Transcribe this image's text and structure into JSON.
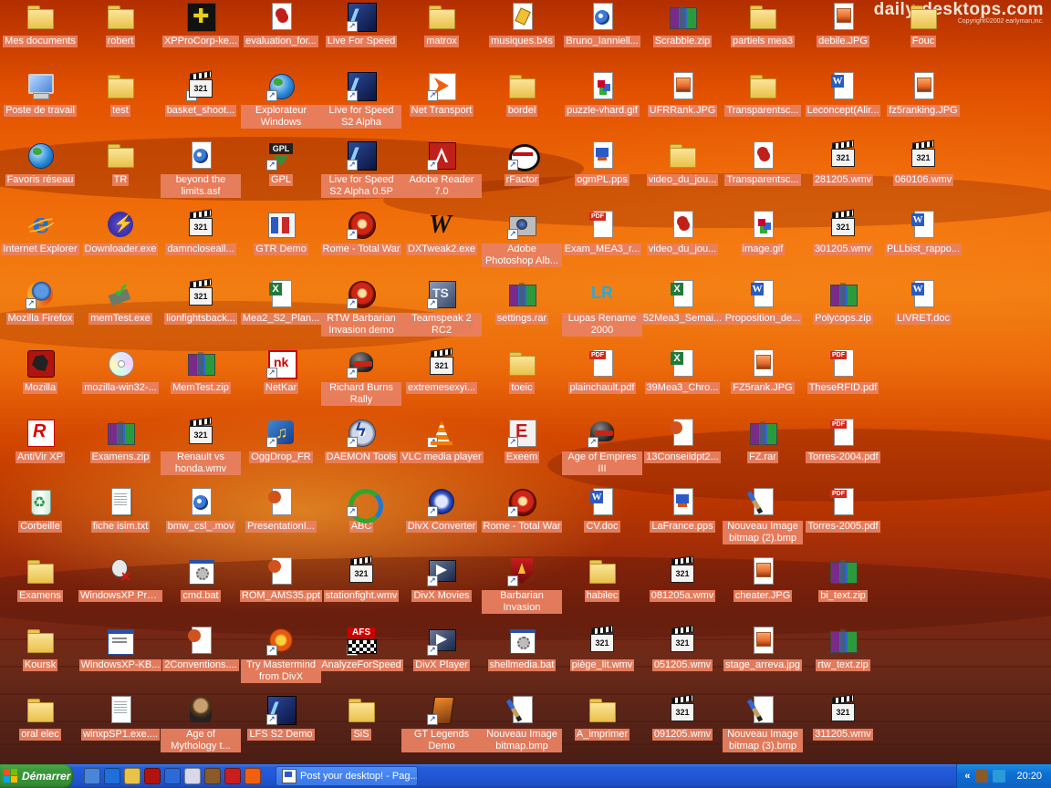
{
  "wallpaper": {
    "brand": "daily-desktops.com",
    "copyright": "Copyright©2002 earlyman,inc."
  },
  "desktop": {
    "icons": [
      {
        "label": "Mes documents",
        "kind": "folder",
        "col": 0,
        "row": 0
      },
      {
        "label": "Poste de travail",
        "kind": "computer",
        "col": 0,
        "row": 1
      },
      {
        "label": "Favoris réseau",
        "kind": "globe",
        "col": 0,
        "row": 2
      },
      {
        "label": "Internet Explorer",
        "kind": "ie",
        "col": 0,
        "row": 3
      },
      {
        "label": "Mozilla Firefox",
        "kind": "firefox",
        "col": 0,
        "row": 4,
        "shortcut": true
      },
      {
        "label": "Mozilla",
        "kind": "mozilla",
        "col": 0,
        "row": 5
      },
      {
        "label": "AntiVir XP",
        "kind": "avira",
        "col": 0,
        "row": 6
      },
      {
        "label": "Corbeille",
        "kind": "recycle",
        "col": 0,
        "row": 7
      },
      {
        "label": "Examens",
        "kind": "folder",
        "col": 0,
        "row": 8
      },
      {
        "label": "Koursk",
        "kind": "folder",
        "col": 0,
        "row": 9
      },
      {
        "label": "oral elec",
        "kind": "folder",
        "col": 0,
        "row": 10
      },
      {
        "label": "robert",
        "kind": "folder",
        "col": 1,
        "row": 0
      },
      {
        "label": "test",
        "kind": "folder",
        "col": 1,
        "row": 1
      },
      {
        "label": "TR",
        "kind": "folder",
        "col": 1,
        "row": 2
      },
      {
        "label": "Downloader.exe",
        "kind": "bolt",
        "col": 1,
        "row": 3
      },
      {
        "label": "memTest.exe",
        "kind": "check",
        "col": 1,
        "row": 4
      },
      {
        "label": "mozilla-win32-...",
        "kind": "cd",
        "col": 1,
        "row": 5
      },
      {
        "label": "Examens.zip",
        "kind": "zip",
        "col": 1,
        "row": 6
      },
      {
        "label": "fiche isim.txt",
        "kind": "doc",
        "col": 1,
        "row": 7
      },
      {
        "label": "WindowsXP Product K...",
        "kind": "keygen",
        "col": 1,
        "row": 8
      },
      {
        "label": "WindowsXP-KB...",
        "kind": "exe",
        "col": 1,
        "row": 9
      },
      {
        "label": "winxpSP1.exe....",
        "kind": "doc",
        "col": 1,
        "row": 10
      },
      {
        "label": "XPProCorp-ke...",
        "kind": "xpp",
        "col": 2,
        "row": 0
      },
      {
        "label": "basket_shoot...",
        "kind": "video",
        "col": 2,
        "row": 1,
        "shortcut": true
      },
      {
        "label": "beyond the limits.asf",
        "kind": "media",
        "col": 2,
        "row": 2,
        "two": true
      },
      {
        "label": "damncloseall...",
        "kind": "video",
        "col": 2,
        "row": 3
      },
      {
        "label": "lionfightsback...",
        "kind": "video",
        "col": 2,
        "row": 4
      },
      {
        "label": "MemTest.zip",
        "kind": "zip",
        "col": 2,
        "row": 5
      },
      {
        "label": "Renault vs honda.wmv",
        "kind": "video",
        "col": 2,
        "row": 6,
        "two": true
      },
      {
        "label": "bmw_csl_.mov",
        "kind": "media",
        "col": 2,
        "row": 7
      },
      {
        "label": "cmd.bat",
        "kind": "bat",
        "col": 2,
        "row": 8
      },
      {
        "label": "2Conventions....",
        "kind": "ppt",
        "col": 2,
        "row": 9
      },
      {
        "label": "Age of Mythology t...",
        "kind": "warrior",
        "col": 2,
        "row": 10,
        "two": true
      },
      {
        "label": "evaluation_for...",
        "kind": "swirl",
        "col": 3,
        "row": 0
      },
      {
        "label": "Explorateur Windows",
        "kind": "globe",
        "col": 3,
        "row": 1,
        "shortcut": true,
        "two": true
      },
      {
        "label": "GPL",
        "kind": "gpl",
        "col": 3,
        "row": 2,
        "shortcut": true
      },
      {
        "label": "GTR Demo",
        "kind": "gui",
        "col": 3,
        "row": 3
      },
      {
        "label": "Mea2_S2_Plan...",
        "kind": "excel",
        "col": 3,
        "row": 4
      },
      {
        "label": "NetKar",
        "kind": "netkar",
        "col": 3,
        "row": 5,
        "shortcut": true
      },
      {
        "label": "OggDrop_FR",
        "kind": "ogg",
        "col": 3,
        "row": 6,
        "shortcut": true
      },
      {
        "label": "PresentationI...",
        "kind": "ppt",
        "col": 3,
        "row": 7
      },
      {
        "label": "ROM_AMS35.ppt",
        "kind": "ppt",
        "col": 3,
        "row": 8
      },
      {
        "label": "Try Mastermind from DivX",
        "kind": "mastermind",
        "col": 3,
        "row": 9,
        "shortcut": true,
        "two": true
      },
      {
        "label": "LFS S2 Demo",
        "kind": "lfs",
        "col": 3,
        "row": 10,
        "shortcut": true
      },
      {
        "label": "Live For Speed",
        "kind": "lfs",
        "col": 4,
        "row": 0,
        "shortcut": true
      },
      {
        "label": "Live for Speed S2 Alpha",
        "kind": "lfs",
        "col": 4,
        "row": 1,
        "shortcut": true,
        "two": true
      },
      {
        "label": "Live for Speed S2 Alpha 0.5P",
        "kind": "lfs",
        "col": 4,
        "row": 2,
        "shortcut": true,
        "two": true
      },
      {
        "label": "Rome - Total War",
        "kind": "rome",
        "col": 4,
        "row": 3,
        "shortcut": true
      },
      {
        "label": "RTW Barbarian Invasion demo",
        "kind": "rome",
        "col": 4,
        "row": 4,
        "shortcut": true,
        "two": true
      },
      {
        "label": "Richard Burns Rally",
        "kind": "helmet",
        "col": 4,
        "row": 5,
        "shortcut": true,
        "two": true
      },
      {
        "label": "DAEMON Tools",
        "kind": "daemon",
        "col": 4,
        "row": 6,
        "shortcut": true
      },
      {
        "label": "ABC",
        "kind": "abc",
        "col": 4,
        "row": 7,
        "shortcut": true
      },
      {
        "label": "stationfight.wmv",
        "kind": "video",
        "col": 4,
        "row": 8
      },
      {
        "label": "AnalyzeForSpeed",
        "kind": "afs",
        "col": 4,
        "row": 9,
        "shortcut": true
      },
      {
        "label": "SiS",
        "kind": "folder",
        "col": 4,
        "row": 10
      },
      {
        "label": "matrox",
        "kind": "folder",
        "col": 5,
        "row": 0
      },
      {
        "label": "Net Transport",
        "kind": "net",
        "col": 5,
        "row": 1,
        "shortcut": true
      },
      {
        "label": "Adobe Reader 7.0",
        "kind": "red",
        "col": 5,
        "row": 2,
        "shortcut": true,
        "two": true
      },
      {
        "label": "DXTweak2.exe",
        "kind": "dxt",
        "col": 5,
        "row": 3
      },
      {
        "label": "Teamspeak 2 RC2",
        "kind": "ts",
        "col": 5,
        "row": 4,
        "shortcut": true,
        "two": true
      },
      {
        "label": "extremesexyi...",
        "kind": "video",
        "col": 5,
        "row": 5
      },
      {
        "label": "VLC media player",
        "kind": "vlc",
        "col": 5,
        "row": 6,
        "shortcut": true
      },
      {
        "label": "DivX Converter",
        "kind": "dvc",
        "col": 5,
        "row": 7,
        "shortcut": true
      },
      {
        "label": "DivX Movies",
        "kind": "divxplayer",
        "col": 5,
        "row": 8,
        "shortcut": true
      },
      {
        "label": "DivX Player",
        "kind": "divxplayer",
        "col": 5,
        "row": 9,
        "shortcut": true
      },
      {
        "label": "GT Legends Demo",
        "kind": "gtl",
        "col": 5,
        "row": 10,
        "shortcut": true,
        "two": true
      },
      {
        "label": "musiques.b4s",
        "kind": "b4s",
        "col": 6,
        "row": 0
      },
      {
        "label": "bordel",
        "kind": "folder",
        "col": 6,
        "row": 1
      },
      {
        "label": "rFactor",
        "kind": "rfactor",
        "col": 6,
        "row": 2,
        "shortcut": true
      },
      {
        "label": "Adobe Photoshop Alb...",
        "kind": "camera",
        "col": 6,
        "row": 3,
        "shortcut": true,
        "two": true
      },
      {
        "label": "settings.rar",
        "kind": "zip",
        "col": 6,
        "row": 4
      },
      {
        "label": "toeic",
        "kind": "folder",
        "col": 6,
        "row": 5
      },
      {
        "label": "Exeem",
        "kind": "exeem",
        "col": 6,
        "row": 6,
        "shortcut": true
      },
      {
        "label": "Rome - Total War",
        "kind": "rome",
        "col": 6,
        "row": 7,
        "shortcut": true
      },
      {
        "label": "Barbarian Invasion",
        "kind": "shield",
        "col": 6,
        "row": 8,
        "shortcut": true,
        "two": true
      },
      {
        "label": "shellmedia.bat",
        "kind": "bat",
        "col": 6,
        "row": 9
      },
      {
        "label": "Nouveau Image bitmap.bmp",
        "kind": "paint",
        "col": 6,
        "row": 10,
        "two": true
      },
      {
        "label": "Bruno_Ianniell...",
        "kind": "media",
        "col": 7,
        "row": 0
      },
      {
        "label": "puzzle-vhard.gif",
        "kind": "gif",
        "col": 7,
        "row": 1
      },
      {
        "label": "ogmPL.pps",
        "kind": "pps",
        "col": 7,
        "row": 2
      },
      {
        "label": "Exam_MEA3_r...",
        "kind": "pdf",
        "col": 7,
        "row": 3
      },
      {
        "label": "Lupas Rename 2000",
        "kind": "lupas",
        "col": 7,
        "row": 4,
        "two": true
      },
      {
        "label": "plainchault.pdf",
        "kind": "pdf",
        "col": 7,
        "row": 5
      },
      {
        "label": "Age of Empires III",
        "kind": "helmet",
        "col": 7,
        "row": 6,
        "shortcut": true,
        "two": true
      },
      {
        "label": "CV.doc",
        "kind": "word",
        "col": 7,
        "row": 7
      },
      {
        "label": "habilec",
        "kind": "folder",
        "col": 7,
        "row": 8
      },
      {
        "label": "piège_lit.wmv",
        "kind": "video",
        "col": 7,
        "row": 9
      },
      {
        "label": "A_imprimer",
        "kind": "folder",
        "col": 7,
        "row": 10
      },
      {
        "label": "Scrabble.zip",
        "kind": "zip",
        "col": 8,
        "row": 0
      },
      {
        "label": "UFRRank.JPG",
        "kind": "image",
        "col": 8,
        "row": 1
      },
      {
        "label": "video_du_jou...",
        "kind": "folder",
        "col": 8,
        "row": 2
      },
      {
        "label": "video_du_jou...",
        "kind": "swirl",
        "col": 8,
        "row": 3
      },
      {
        "label": "52Mea3_Semai...",
        "kind": "excel",
        "col": 8,
        "row": 4
      },
      {
        "label": "39Mea3_Chro...",
        "kind": "excel",
        "col": 8,
        "row": 5
      },
      {
        "label": "13Conseildpt2...",
        "kind": "ppt",
        "col": 8,
        "row": 6
      },
      {
        "label": "LaFrance.pps",
        "kind": "pps",
        "col": 8,
        "row": 7
      },
      {
        "label": "081205a.wmv",
        "kind": "video",
        "col": 8,
        "row": 8
      },
      {
        "label": "051205.wmv",
        "kind": "video",
        "col": 8,
        "row": 9
      },
      {
        "label": "091205.wmv",
        "kind": "video",
        "col": 8,
        "row": 10
      },
      {
        "label": "partiels mea3",
        "kind": "folder",
        "col": 9,
        "row": 0
      },
      {
        "label": "Transparentsc...",
        "kind": "folder",
        "col": 9,
        "row": 1
      },
      {
        "label": "Transparentsc...",
        "kind": "swirl",
        "col": 9,
        "row": 2
      },
      {
        "label": "image.gif",
        "kind": "gif",
        "col": 9,
        "row": 3
      },
      {
        "label": "Proposition_de...",
        "kind": "word",
        "col": 9,
        "row": 4
      },
      {
        "label": "FZ5rank.JPG",
        "kind": "image",
        "col": 9,
        "row": 5
      },
      {
        "label": "FZ.rar",
        "kind": "zip",
        "col": 9,
        "row": 6
      },
      {
        "label": "Nouveau Image bitmap (2).bmp",
        "kind": "paint",
        "col": 9,
        "row": 7,
        "two": true
      },
      {
        "label": "cheater.JPG",
        "kind": "image",
        "col": 9,
        "row": 8
      },
      {
        "label": "stage_arreva.jpg",
        "kind": "image",
        "col": 9,
        "row": 9
      },
      {
        "label": "Nouveau Image bitmap (3).bmp",
        "kind": "paint",
        "col": 9,
        "row": 10,
        "two": true
      },
      {
        "label": "debile.JPG",
        "kind": "image",
        "col": 10,
        "row": 0
      },
      {
        "label": "Leconcept(Alir...",
        "kind": "word",
        "col": 10,
        "row": 1
      },
      {
        "label": "281205.wmv",
        "kind": "video",
        "col": 10,
        "row": 2
      },
      {
        "label": "301205.wmv",
        "kind": "video",
        "col": 10,
        "row": 3
      },
      {
        "label": "Polycops.zip",
        "kind": "zip",
        "col": 10,
        "row": 4
      },
      {
        "label": "TheseRFID.pdf",
        "kind": "pdf",
        "col": 10,
        "row": 5
      },
      {
        "label": "Torres-2004.pdf",
        "kind": "pdf",
        "col": 10,
        "row": 6
      },
      {
        "label": "Torres-2005.pdf",
        "kind": "pdf",
        "col": 10,
        "row": 7
      },
      {
        "label": "bi_text.zip",
        "kind": "zip",
        "col": 10,
        "row": 8
      },
      {
        "label": "rtw_text.zip",
        "kind": "zip",
        "col": 10,
        "row": 9
      },
      {
        "label": "311205.wmv",
        "kind": "video",
        "col": 10,
        "row": 10
      },
      {
        "label": "Fouc",
        "kind": "folder",
        "col": 11,
        "row": 0
      },
      {
        "label": "fz5ranking.JPG",
        "kind": "image",
        "col": 11,
        "row": 1
      },
      {
        "label": "060106.wmv",
        "kind": "video",
        "col": 11,
        "row": 2
      },
      {
        "label": "PLLbist_rappo...",
        "kind": "word",
        "col": 11,
        "row": 3
      },
      {
        "label": "LIVRET.doc",
        "kind": "word",
        "col": 11,
        "row": 4
      }
    ]
  },
  "taskbar": {
    "start_label": "Démarrer",
    "quick_launch": [
      {
        "icon": "desktop-icon",
        "color": "#4a86d8"
      },
      {
        "icon": "ie-icon",
        "color": "#1e6fd9"
      },
      {
        "icon": "folder-icon",
        "color": "#e9c24a"
      },
      {
        "icon": "mozilla-icon",
        "color": "#b1140e"
      },
      {
        "icon": "media-player-icon",
        "color": "#2d6ad8"
      },
      {
        "icon": "disc-icon",
        "color": "#d8d8e8"
      },
      {
        "icon": "warrior-icon",
        "color": "#8a5a2a"
      },
      {
        "icon": "shield-icon",
        "color": "#c81e1e"
      },
      {
        "icon": "net-transport-icon",
        "color": "#f06010"
      }
    ],
    "task_label": "Post your desktop! - Pag...",
    "tray": {
      "expand": "«",
      "icons": [
        {
          "icon": "tray-warrior-icon",
          "color": "#8a5a2a"
        },
        {
          "icon": "tray-network-icon",
          "color": "#2a9ad8"
        }
      ],
      "time": "20:20"
    }
  }
}
